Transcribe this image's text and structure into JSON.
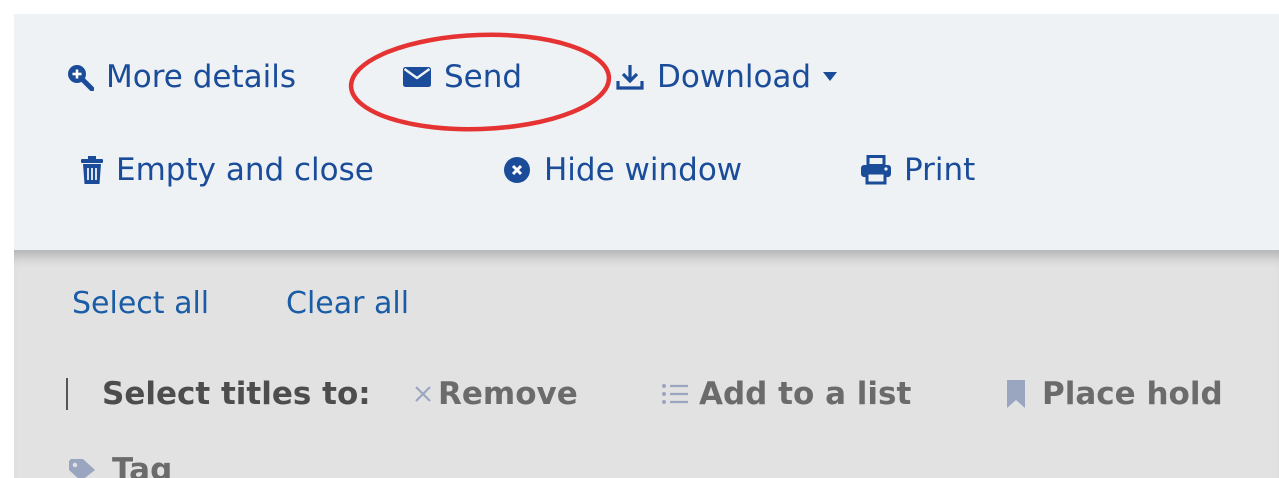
{
  "toolbar": {
    "more_details": "More details",
    "send": "Send",
    "download": "Download",
    "empty_close": "Empty and close",
    "hide_window": "Hide window",
    "print": "Print"
  },
  "selection": {
    "select_all": "Select all",
    "clear_all": "Clear all",
    "select_titles_label": "Select titles to:",
    "remove": "Remove",
    "add_to_list": "Add to a list",
    "place_hold": "Place hold",
    "tag": "Tag"
  },
  "annotation": {
    "highlight_target": "send-button",
    "highlight_color": "#e53333"
  },
  "colors": {
    "link_blue": "#1a4c99",
    "toolbar_bg": "#eef2f5",
    "panel_bg": "#e2e2e2",
    "disabled_text": "#6b6b6b"
  }
}
